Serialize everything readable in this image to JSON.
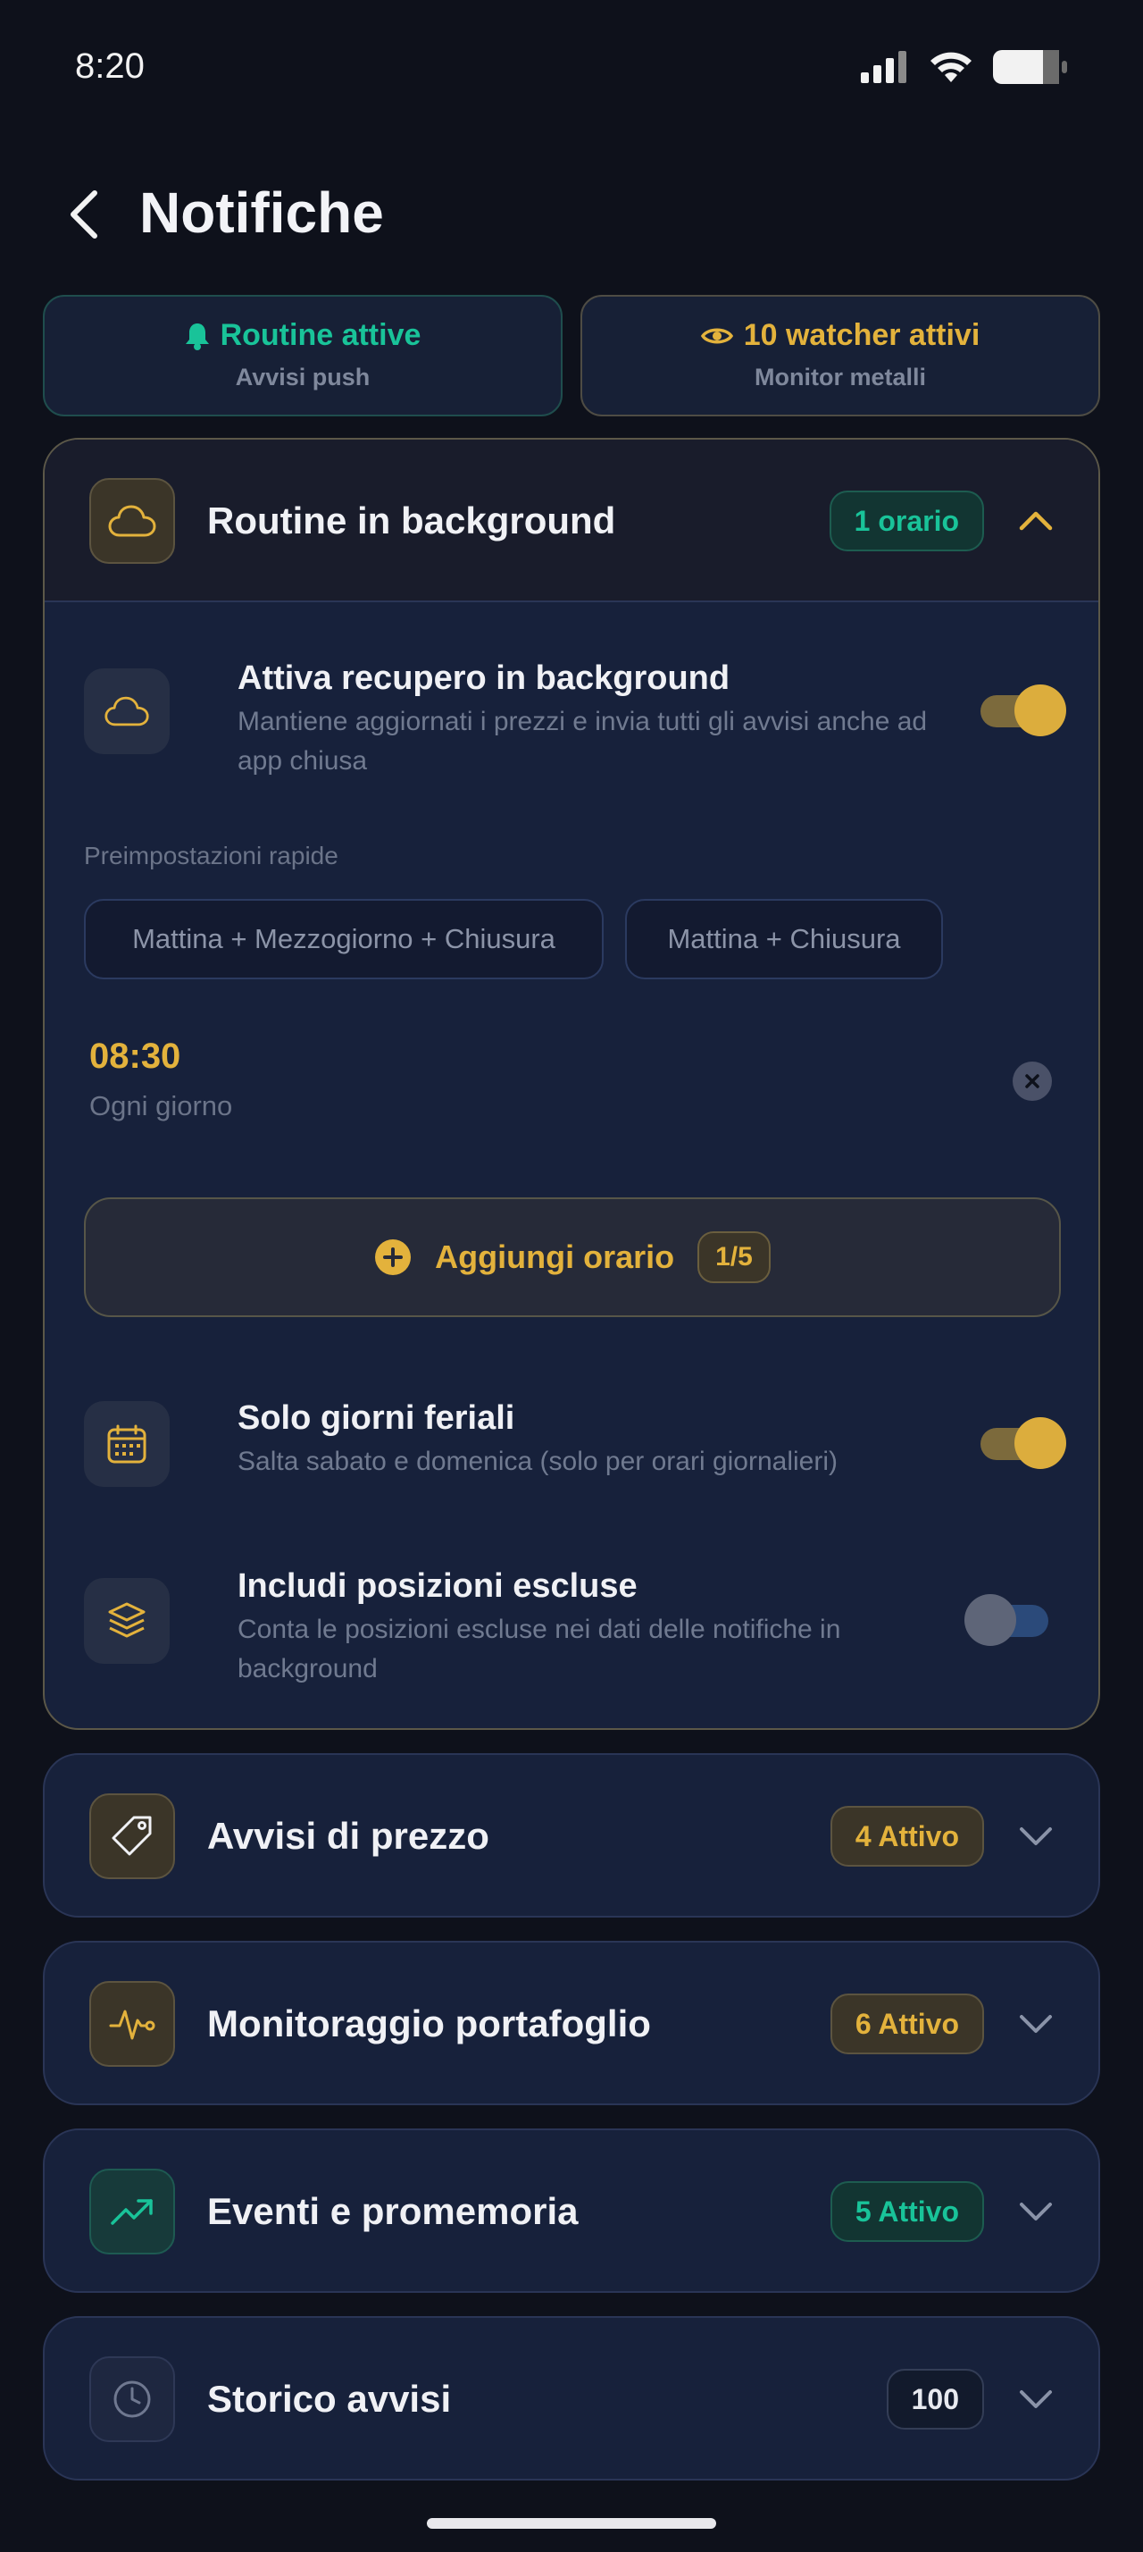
{
  "status_bar": {
    "time": "8:20"
  },
  "header": {
    "title": "Notifiche"
  },
  "chips": {
    "routine": {
      "title": "Routine attive",
      "subtitle": "Avvisi push",
      "color": "#19c399"
    },
    "watcher": {
      "title": "10 watcher attivi",
      "subtitle": "Monitor metalli",
      "color": "#e3b23c"
    }
  },
  "background_routine": {
    "title": "Routine in background",
    "badge": "1 orario",
    "expanded": true,
    "enable_row": {
      "title": "Attiva recupero in background",
      "description": "Mantiene aggiornati i prezzi e invia tutti gli avvisi anche ad app chiusa",
      "enabled": true
    },
    "presets_label": "Preimpostazioni rapide",
    "presets": [
      "Mattina + Mezzogiorno + Chiusura",
      "Mattina + Chiusura"
    ],
    "schedules": [
      {
        "time": "08:30",
        "repeat": "Ogni giorno"
      }
    ],
    "add_button": {
      "label": "Aggiungi orario",
      "count": "1/5"
    },
    "weekdays_row": {
      "title": "Solo giorni feriali",
      "description": "Salta sabato e domenica (solo per orari giornalieri)",
      "enabled": true
    },
    "excluded_row": {
      "title": "Includi posizioni escluse",
      "description": "Conta le posizioni escluse nei dati delle notifiche in background",
      "enabled": false
    }
  },
  "sections": [
    {
      "title": "Avvisi di prezzo",
      "badge": "4 Attivo",
      "icon": "tag-icon"
    },
    {
      "title": "Monitoraggio portafoglio",
      "badge": "6 Attivo",
      "icon": "pulse-icon"
    },
    {
      "title": "Eventi e promemoria",
      "badge": "5 Attivo",
      "icon": "trending-up-icon"
    },
    {
      "title": "Storico avvisi",
      "badge": "100",
      "icon": "clock-icon"
    }
  ],
  "colors": {
    "background": "#0e111b",
    "panel": "#17213b",
    "accent_gold": "#e3b23c",
    "accent_green": "#19c399"
  }
}
